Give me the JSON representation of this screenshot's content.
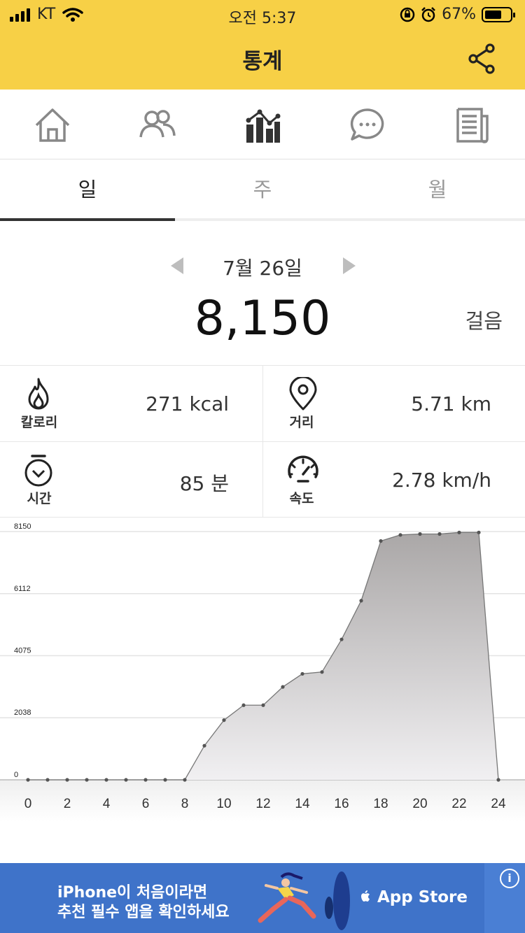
{
  "status_bar": {
    "carrier": "KT",
    "time": "오전 5:37",
    "battery": "67%"
  },
  "header": {
    "title": "통계"
  },
  "nav": [
    "home-icon",
    "friends-icon",
    "statistics-icon",
    "chat-icon",
    "news-icon"
  ],
  "tabs": [
    {
      "label": "일",
      "active": true
    },
    {
      "label": "주",
      "active": false
    },
    {
      "label": "월",
      "active": false
    }
  ],
  "date": "7월 26일",
  "steps": {
    "value": "8,150",
    "unit": "걸음"
  },
  "stats": {
    "calories": {
      "label": "칼로리",
      "value": "271 kcal"
    },
    "distance": {
      "label": "거리",
      "value": "5.71 km"
    },
    "time": {
      "label": "시간",
      "value": "85 분"
    },
    "speed": {
      "label": "속도",
      "value": "2.78 km/h"
    }
  },
  "chart_data": {
    "type": "area",
    "x": [
      0,
      1,
      2,
      3,
      4,
      5,
      6,
      7,
      8,
      9,
      10,
      11,
      12,
      13,
      14,
      15,
      16,
      17,
      18,
      19,
      20,
      21,
      22,
      23,
      24
    ],
    "values": [
      0,
      0,
      0,
      0,
      0,
      0,
      0,
      0,
      0,
      1120,
      1960,
      2450,
      2450,
      3050,
      3480,
      3540,
      4610,
      5880,
      7840,
      8040,
      8070,
      8070,
      8120,
      8120,
      0
    ],
    "xticks": [
      "0",
      "2",
      "4",
      "6",
      "8",
      "10",
      "12",
      "14",
      "16",
      "18",
      "20",
      "22",
      "24"
    ],
    "yticks": [
      "0",
      "2038",
      "4075",
      "6112",
      "8150"
    ],
    "ylim": [
      0,
      8150
    ],
    "xlim": [
      0,
      24
    ],
    "grid": true
  },
  "ad": {
    "line1": "iPhone이 처음이라면",
    "line2": "추천 필수 앱을 확인하세요",
    "store": "App Store",
    "info": "i"
  }
}
